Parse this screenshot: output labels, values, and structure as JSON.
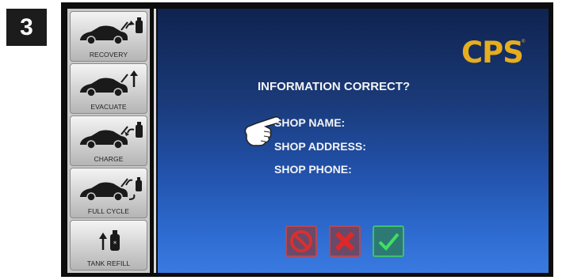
{
  "step_number": "3",
  "sidebar": {
    "items": [
      {
        "label": "RECOVERY",
        "icon": "car-recovery-icon"
      },
      {
        "label": "EVACUATE",
        "icon": "car-evacuate-icon"
      },
      {
        "label": "CHARGE",
        "icon": "car-charge-icon"
      },
      {
        "label": "FULL CYCLE",
        "icon": "car-full-cycle-icon"
      },
      {
        "label": "TANK REFILL",
        "icon": "tank-refill-icon"
      }
    ]
  },
  "brand": {
    "logo_text": "CPS",
    "registered_mark": "®",
    "logo_color": "#e6ad1e"
  },
  "dialog": {
    "question": "INFORMATION CORRECT?",
    "shop_name_label": "SHOP NAME:",
    "shop_address_label": "SHOP ADDRESS:",
    "shop_phone_label": "SHOP PHONE:"
  },
  "actions": {
    "cancel": {
      "icon": "prohibited-icon",
      "color": "#d03030"
    },
    "no": {
      "icon": "x-icon",
      "color": "#e02828"
    },
    "yes": {
      "icon": "check-icon",
      "color": "#3fd060"
    }
  },
  "colors": {
    "screen_top": "#0f2350",
    "screen_bottom": "#3a7ae0",
    "sidebar_bg": "#c9c9c9"
  }
}
